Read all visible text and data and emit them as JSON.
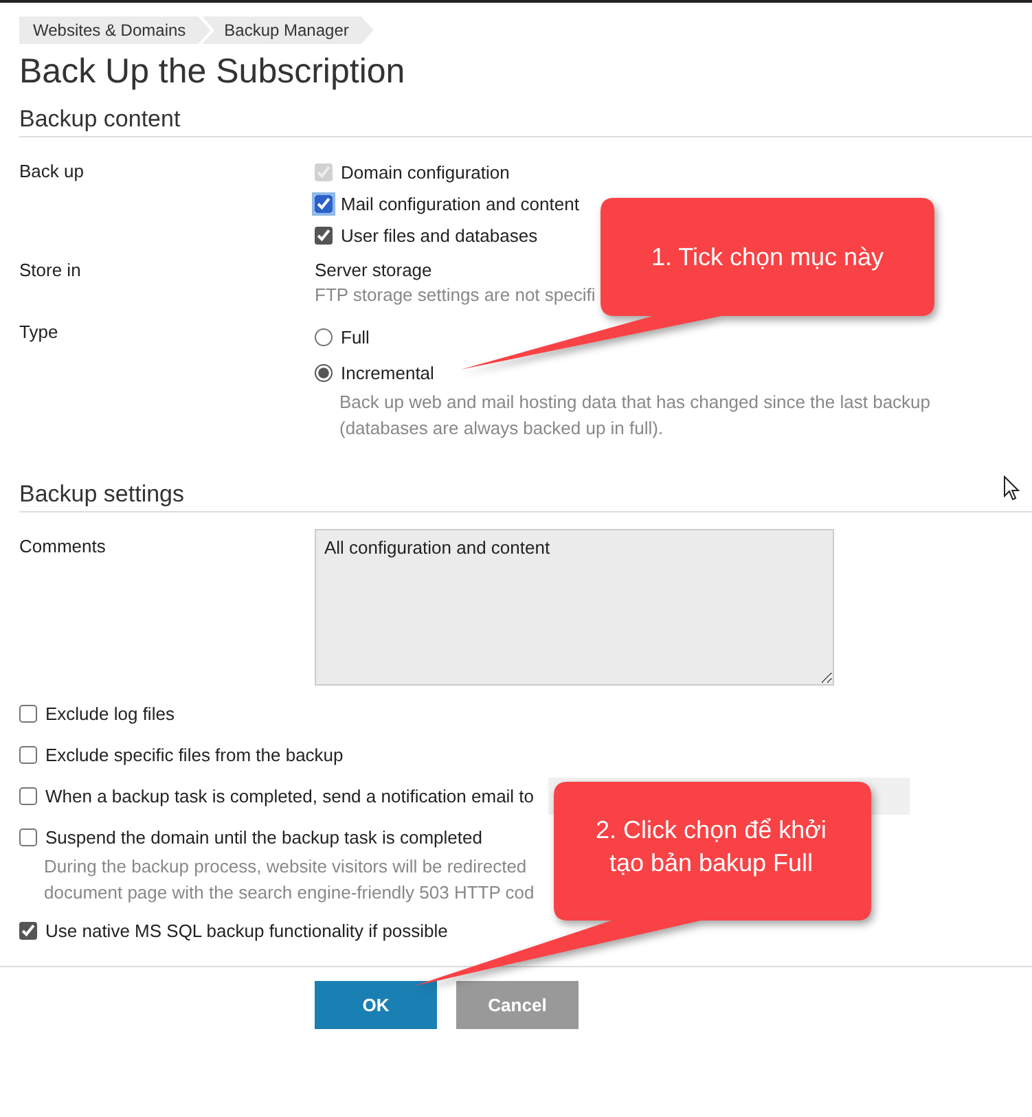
{
  "breadcrumbs": [
    "Websites & Domains",
    "Backup Manager"
  ],
  "title": "Back Up the Subscription",
  "backup_content": {
    "heading": "Backup content",
    "back_up": {
      "label": "Back up",
      "options": [
        {
          "label": "Domain configuration",
          "checked": true,
          "disabled": true,
          "focused": false
        },
        {
          "label": "Mail configuration and content",
          "checked": true,
          "disabled": false,
          "focused": true
        },
        {
          "label": "User files and databases",
          "checked": true,
          "disabled": false,
          "focused": false
        }
      ]
    },
    "store_in": {
      "label": "Store in",
      "value": "Server storage",
      "hint": "FTP storage settings are not specifi"
    },
    "type": {
      "label": "Type",
      "options": [
        {
          "label": "Full",
          "selected": false
        },
        {
          "label": "Incremental",
          "selected": true,
          "description": [
            "Back up web and mail hosting data that has changed since the last backup",
            "(databases are always backed up in full)."
          ]
        }
      ]
    }
  },
  "backup_settings": {
    "heading": "Backup settings",
    "comments": {
      "label": "Comments",
      "value": "All configuration and content"
    },
    "options": [
      {
        "kind": "checkbox",
        "label": "Exclude log files",
        "checked": false
      },
      {
        "kind": "checkbox",
        "label": "Exclude specific files from the backup",
        "checked": false
      },
      {
        "kind": "email",
        "label": "When a backup task is completed, send a notification email to",
        "checked": false
      },
      {
        "kind": "checkbox",
        "label": "Suspend the domain until the backup task is completed",
        "checked": false,
        "description": [
          "During the backup process, website visitors will be redirected",
          "document page with the search engine-friendly 503 HTTP cod"
        ]
      },
      {
        "kind": "checkbox",
        "label": "Use native MS SQL backup functionality if possible",
        "checked": true
      }
    ]
  },
  "buttons": [
    {
      "label": "OK",
      "kind": "primary"
    },
    {
      "label": "Cancel",
      "kind": "secondary"
    }
  ],
  "callouts": [
    {
      "text": "1. Tick chọn mục này"
    },
    {
      "text": "2. Click chọn để khởi tạo bản bakup Full"
    }
  ]
}
